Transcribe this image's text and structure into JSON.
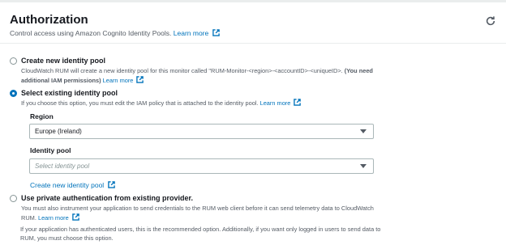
{
  "header": {
    "title": "Authorization",
    "description": "Control access using Amazon Cognito Identity Pools.",
    "learn_more": "Learn more",
    "refresh_icon": "refresh-icon"
  },
  "options": {
    "create": {
      "label": "Create new identity pool",
      "desc_plain": "CloudWatch RUM will create a new identity pool for this monitor called \"RUM-Monitor-<region>-<accountID>-<uniqueID>.",
      "desc_bold": "(You need additional IAM permissions)",
      "learn_more": "Learn more",
      "selected": false
    },
    "existing": {
      "label": "Select existing identity pool",
      "desc": "If you choose this option, you must edit the IAM policy that is attached to the identity pool.",
      "learn_more": "Learn more",
      "selected": true,
      "region_label": "Region",
      "region_value": "Europe (Ireland)",
      "pool_label": "Identity pool",
      "pool_placeholder": "Select identity pool",
      "create_link": "Create new identity pool"
    },
    "private": {
      "label": "Use private authentication from existing provider.",
      "desc": "You must also instrument your application to send credentials to the RUM web client before it can send telemetry data to CloudWatch RUM.",
      "learn_more": "Learn more",
      "selected": false
    }
  },
  "note": "If your application has authenticated users, this is the recommended option. Additionally, if you want only logged in users to send data to RUM, you must choose this option.",
  "colors": {
    "link": "#0073bb",
    "text": "#16191f",
    "muted": "#545b64",
    "border": "#aab7b8"
  }
}
